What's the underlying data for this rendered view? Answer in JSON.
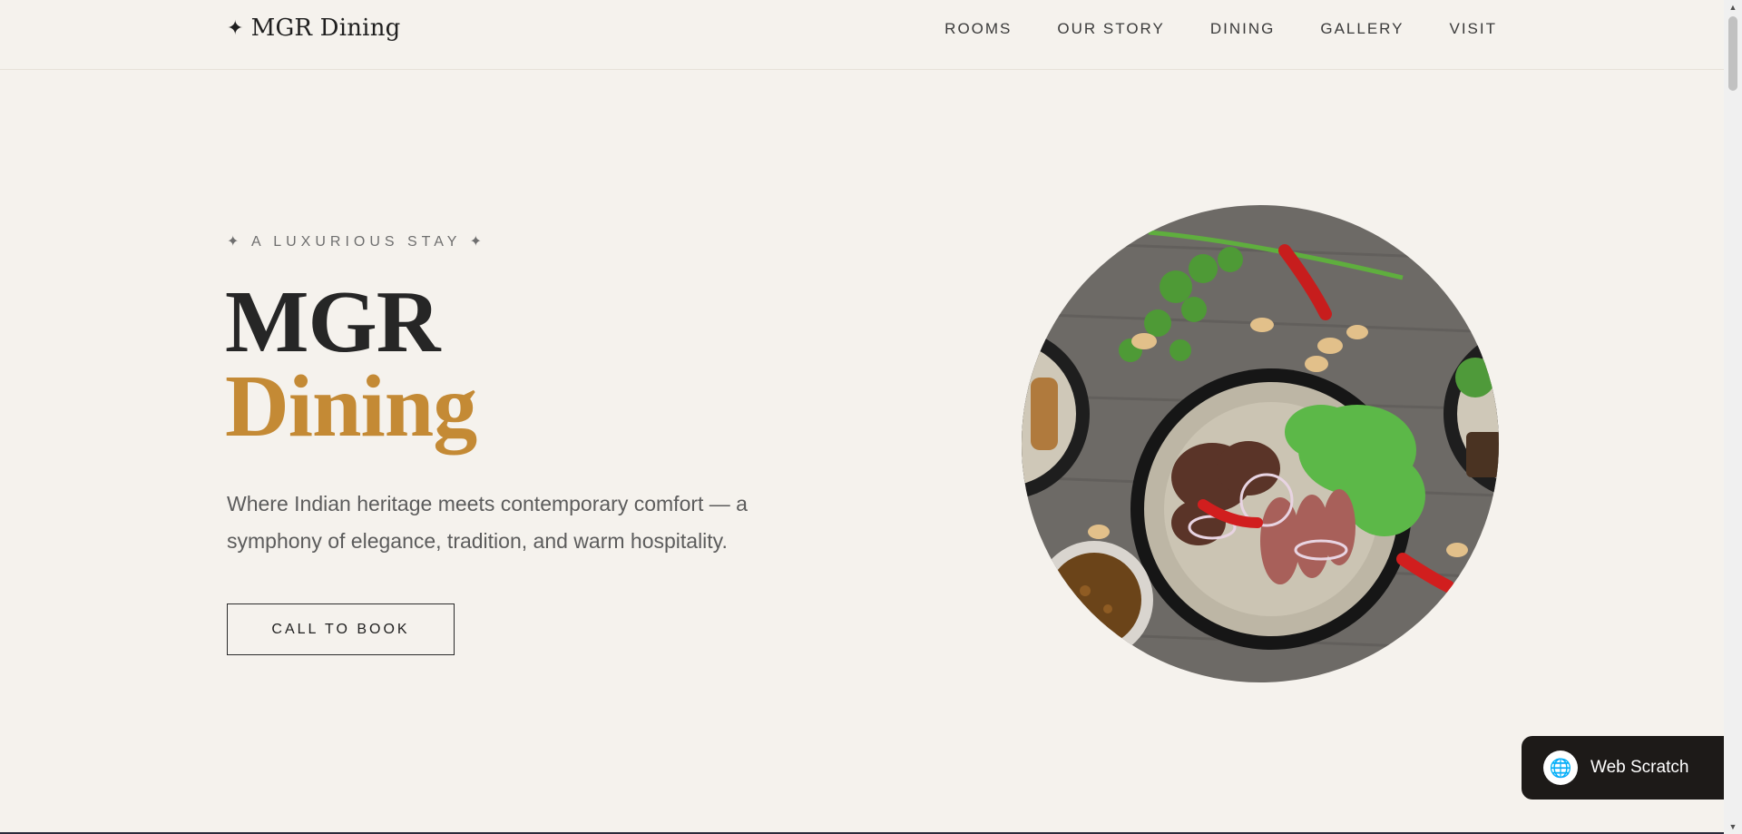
{
  "header": {
    "logo_icon": "✦",
    "logo_text": "MGR Dining",
    "nav": [
      "ROOMS",
      "OUR STORY",
      "DINING",
      "GALLERY",
      "VISIT"
    ]
  },
  "hero": {
    "eyebrow": "✦  A LUXURIOUS STAY  ✦",
    "title_line1": "MGR",
    "title_line2": "Dining",
    "description": "Where Indian heritage meets contemporary comfort — a symphony of elegance, tradition, and warm hospitality.",
    "cta_label": "CALL TO BOOK",
    "image_alt": "Plate of seared meat with salad, chillies and cashews"
  },
  "badge": {
    "label": "Web Scratch",
    "icon": "globe-icon"
  },
  "colors": {
    "background": "#f5f2ed",
    "accent": "#c48a35",
    "text_dark": "#262626",
    "badge_bg": "#1d1a18"
  }
}
